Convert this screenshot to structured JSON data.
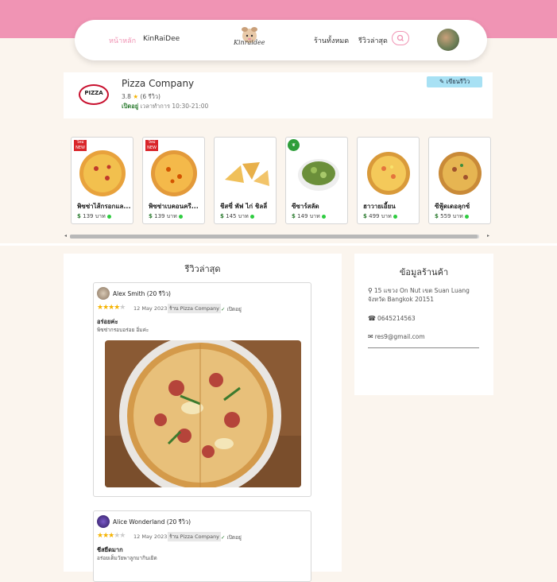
{
  "nav": {
    "home": "หน้าหลัก",
    "brand": "KinRaiDee",
    "logo_text": "Kinraidee",
    "all_shops": "ร้านทั้งหมด",
    "latest_reviews": "รีวิวล่าสุด",
    "search_icon": "search-icon"
  },
  "shop": {
    "logo_text": "PIZZA",
    "name": "Pizza Company",
    "rating": "3.8",
    "review_count": "(6 รีวิว)",
    "open_label": "เปิดอยู่",
    "hours": "เวลาทำการ 10:30-21:00",
    "write_review": "เขียนรีวิว"
  },
  "menu": [
    {
      "name": "พิซซ่าไส้กรอกแล...",
      "price": "139 บาท",
      "badge": "ใหม่ NEW"
    },
    {
      "name": "พิซซ่าเบคอนครี...",
      "price": "139 บาท",
      "badge": "ใหม่ NEW"
    },
    {
      "name": "ชีสซี่ พัฟ ไก่ ชิลลี่",
      "price": "145 บาท",
      "badge": ""
    },
    {
      "name": "ซีซาร์สลัด",
      "price": "149 บาท",
      "badge": "veg"
    },
    {
      "name": "ฮาวายเอี้ยน",
      "price": "499 บาท",
      "badge": ""
    },
    {
      "name": "ซีฟู้ดเดอลุกซ์",
      "price": "559 บาท",
      "badge": ""
    }
  ],
  "reviews": {
    "title": "รีวิวล่าสุด",
    "items": [
      {
        "user": "Alex Smith (20 รีวิว)",
        "stars": 4,
        "date": "12 May 2023",
        "shop": "ร้าน Pizza Company",
        "open": "เปิดอยู่",
        "title": "อร่อยค่ะ",
        "body": "พิซซ่ากรอบอร่อย อิ่มค่ะ"
      },
      {
        "user": "Alice Wonderland (20 รีวิว)",
        "stars": 3,
        "date": "12 May 2023",
        "shop": "ร้าน Pizza Company",
        "open": "เปิดอยู่",
        "title": "ชีสยืดมาก",
        "body": "อร่อยเต็มวัยพาลูกมากินเยิด"
      }
    ]
  },
  "info": {
    "title": "ข้อมูลร้านค้า",
    "address": "15 แขวง On Nut เขต Suan Luang จังหวัด Bangkok 20151",
    "phone": "0645214563",
    "email": "res9@gmail.com"
  },
  "colors": {
    "brand_pink": "#f094b4",
    "open_green": "#2e7d32",
    "star": "#f5b301",
    "write_btn": "#a8e1f4"
  }
}
